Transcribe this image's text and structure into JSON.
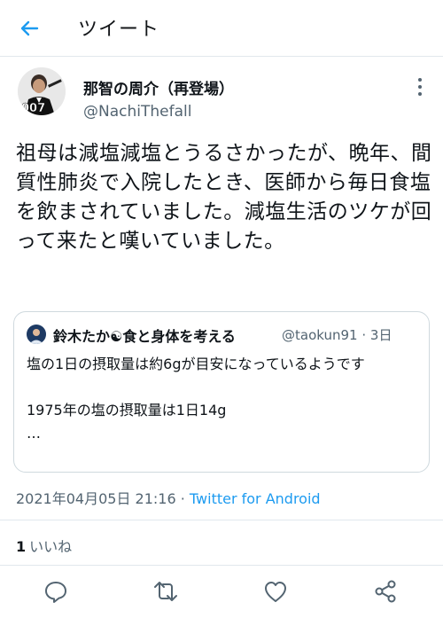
{
  "header": {
    "title": "ツイート",
    "back_icon": "arrow-left-icon"
  },
  "author": {
    "display_name": "那智の周介（再登場）",
    "handle": "@NachiThefall",
    "avatar_text": "007"
  },
  "tweet": {
    "text": "祖母は減塩減塩とうるさかったが、晩年、間質性肺炎で入院したとき、医師から毎日食塩を飲まされていました。減塩生活のツケが回って来たと嘆いていました。"
  },
  "quoted_tweet": {
    "display_name": "鈴木たか☯食と身体を考える",
    "handle": "@taokun91",
    "separator": "·",
    "time": "3日",
    "text": "塩の1日の摂取量は約6gが目安になっているようです\n\n1975年の塩の摂取量は1日14g\n…"
  },
  "meta": {
    "timestamp": "2021年04月05日 21:16",
    "separator": " · ",
    "source": "Twitter for Android"
  },
  "stats": {
    "likes_count": "1",
    "likes_label": "いいね"
  },
  "actions": [
    "reply-icon",
    "retweet-icon",
    "like-icon",
    "share-icon"
  ],
  "colors": {
    "accent": "#1d9bf0",
    "text": "#0f1419",
    "secondary": "#536471",
    "border": "#e1e8ed"
  }
}
